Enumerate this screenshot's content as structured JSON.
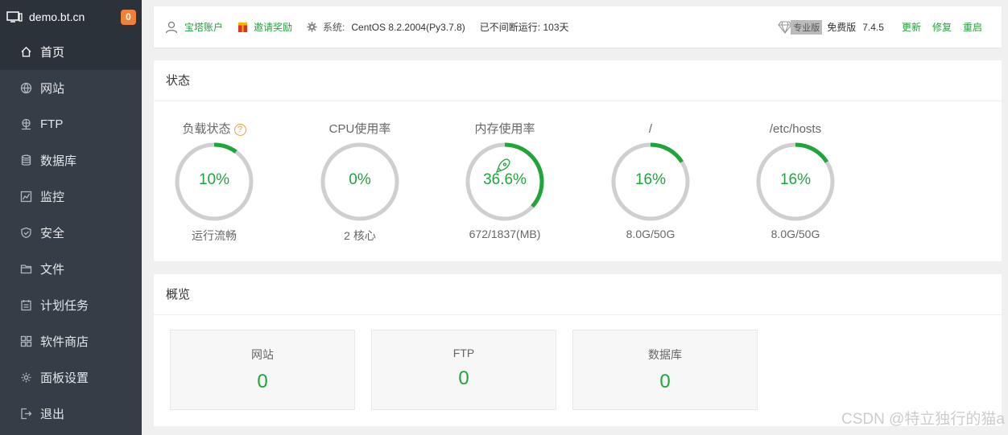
{
  "sidebar": {
    "host": "demo.bt.cn",
    "badge": "0",
    "items": [
      {
        "label": "首页",
        "icon": "home-icon"
      },
      {
        "label": "网站",
        "icon": "globe-icon"
      },
      {
        "label": "FTP",
        "icon": "ftp-icon"
      },
      {
        "label": "数据库",
        "icon": "database-icon"
      },
      {
        "label": "监控",
        "icon": "monitor-chart-icon"
      },
      {
        "label": "安全",
        "icon": "shield-icon"
      },
      {
        "label": "文件",
        "icon": "folder-icon"
      },
      {
        "label": "计划任务",
        "icon": "calendar-icon"
      },
      {
        "label": "软件商店",
        "icon": "apps-grid-icon"
      },
      {
        "label": "面板设置",
        "icon": "gear-icon"
      },
      {
        "label": "退出",
        "icon": "logout-icon"
      }
    ]
  },
  "topbar": {
    "account": "宝塔账户",
    "invite": "邀请奖励",
    "system_label": "系统:",
    "system_value": "CentOS 8.2.2004(Py3.7.8)",
    "uptime": "已不间断运行: 103天",
    "pro_tag": "专业版",
    "edition": "免费版",
    "version": "7.4.5",
    "update": "更新",
    "repair": "修复",
    "restart": "重启"
  },
  "status": {
    "title": "状态",
    "gauges": [
      {
        "title": "负载状态",
        "value": "10%",
        "fraction": 0.1,
        "sub": "运行流畅",
        "help": "?"
      },
      {
        "title": "CPU使用率",
        "value": "0%",
        "fraction": 0.0,
        "sub": "2 核心"
      },
      {
        "title": "内存使用率",
        "value": "36.6%",
        "fraction": 0.366,
        "sub": "672/1837(MB)"
      },
      {
        "title": "/",
        "value": "16%",
        "fraction": 0.16,
        "sub": "8.0G/50G"
      },
      {
        "title": "/etc/hosts",
        "value": "16%",
        "fraction": 0.16,
        "sub": "8.0G/50G"
      }
    ]
  },
  "overview": {
    "title": "概览",
    "cards": [
      {
        "title": "网站",
        "value": "0"
      },
      {
        "title": "FTP",
        "value": "0"
      },
      {
        "title": "数据库",
        "value": "0"
      }
    ]
  },
  "colors": {
    "accent": "#20a53a",
    "sidebar": "#353d47",
    "badge": "#f0813b"
  },
  "watermark": "CSDN @特立独行的猫a"
}
